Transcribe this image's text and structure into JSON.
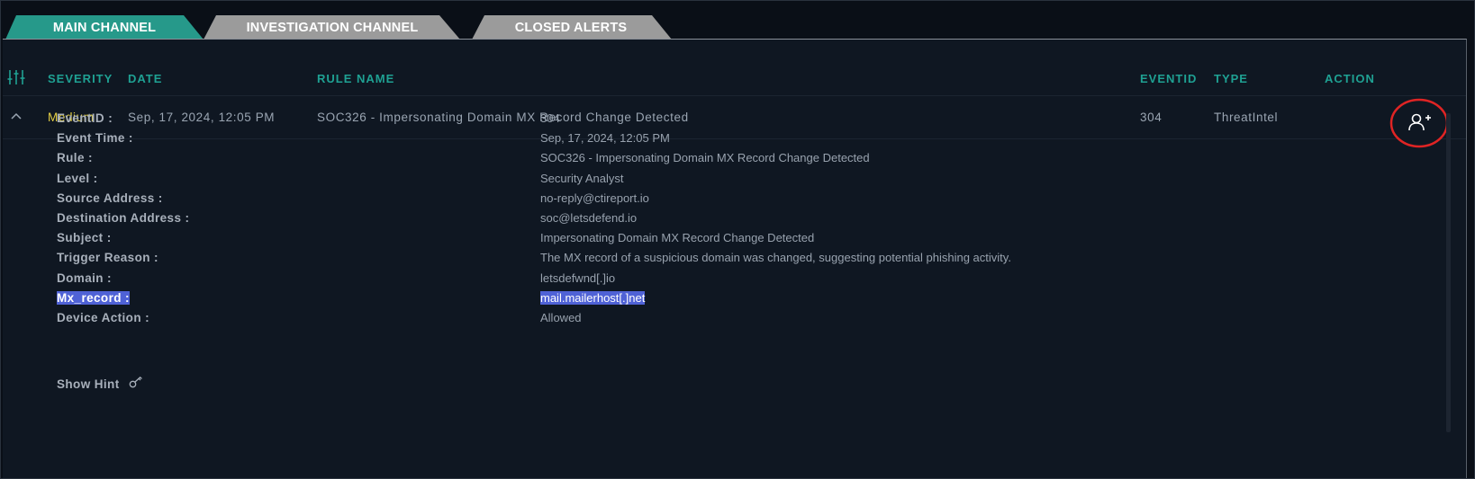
{
  "tabs": [
    {
      "label": "MAIN CHANNEL",
      "active": true
    },
    {
      "label": "INVESTIGATION CHANNEL",
      "active": false
    },
    {
      "label": "CLOSED ALERTS",
      "active": false
    }
  ],
  "colors": {
    "accent": "#1fa193",
    "severity_medium": "#e4cf44",
    "highlight": "#4f62d6",
    "tab_active": "#26998a",
    "tab_inactive": "#9a9a9a"
  },
  "table": {
    "headers": {
      "severity": "SEVERITY",
      "date": "DATE",
      "rule_name": "RULE NAME",
      "eventid": "EVENTID",
      "type": "TYPE",
      "action": "ACTION"
    },
    "row": {
      "severity": "Medium",
      "date": "Sep, 17, 2024, 12:05 PM",
      "rule_name": "SOC326 - Impersonating Domain MX Record Change Detected",
      "eventid": "304",
      "type": "ThreatIntel",
      "action_icon": "assign-user-icon"
    }
  },
  "details": [
    {
      "label": "EventID :",
      "value": "304"
    },
    {
      "label": "Event Time :",
      "value": "Sep, 17, 2024, 12:05 PM"
    },
    {
      "label": "Rule :",
      "value": "SOC326 - Impersonating Domain MX Record Change Detected"
    },
    {
      "label": "Level :",
      "value": "Security Analyst"
    },
    {
      "label": "Source Address :",
      "value": "no-reply@ctireport.io"
    },
    {
      "label": "Destination Address :",
      "value": "soc@letsdefend.io"
    },
    {
      "label": "Subject :",
      "value": "Impersonating Domain MX Record Change Detected"
    },
    {
      "label": "Trigger Reason :",
      "value": "The MX record of a suspicious domain was changed, suggesting potential phishing activity."
    },
    {
      "label": "Domain :",
      "value": "letsdefwnd[.]io"
    },
    {
      "label": "Mx_record :",
      "value": "mail.mailerhost[.]net",
      "highlighted": true
    },
    {
      "label": "Device Action :",
      "value": "Allowed"
    }
  ],
  "hint": {
    "label": "Show Hint",
    "icon": "key-icon"
  }
}
